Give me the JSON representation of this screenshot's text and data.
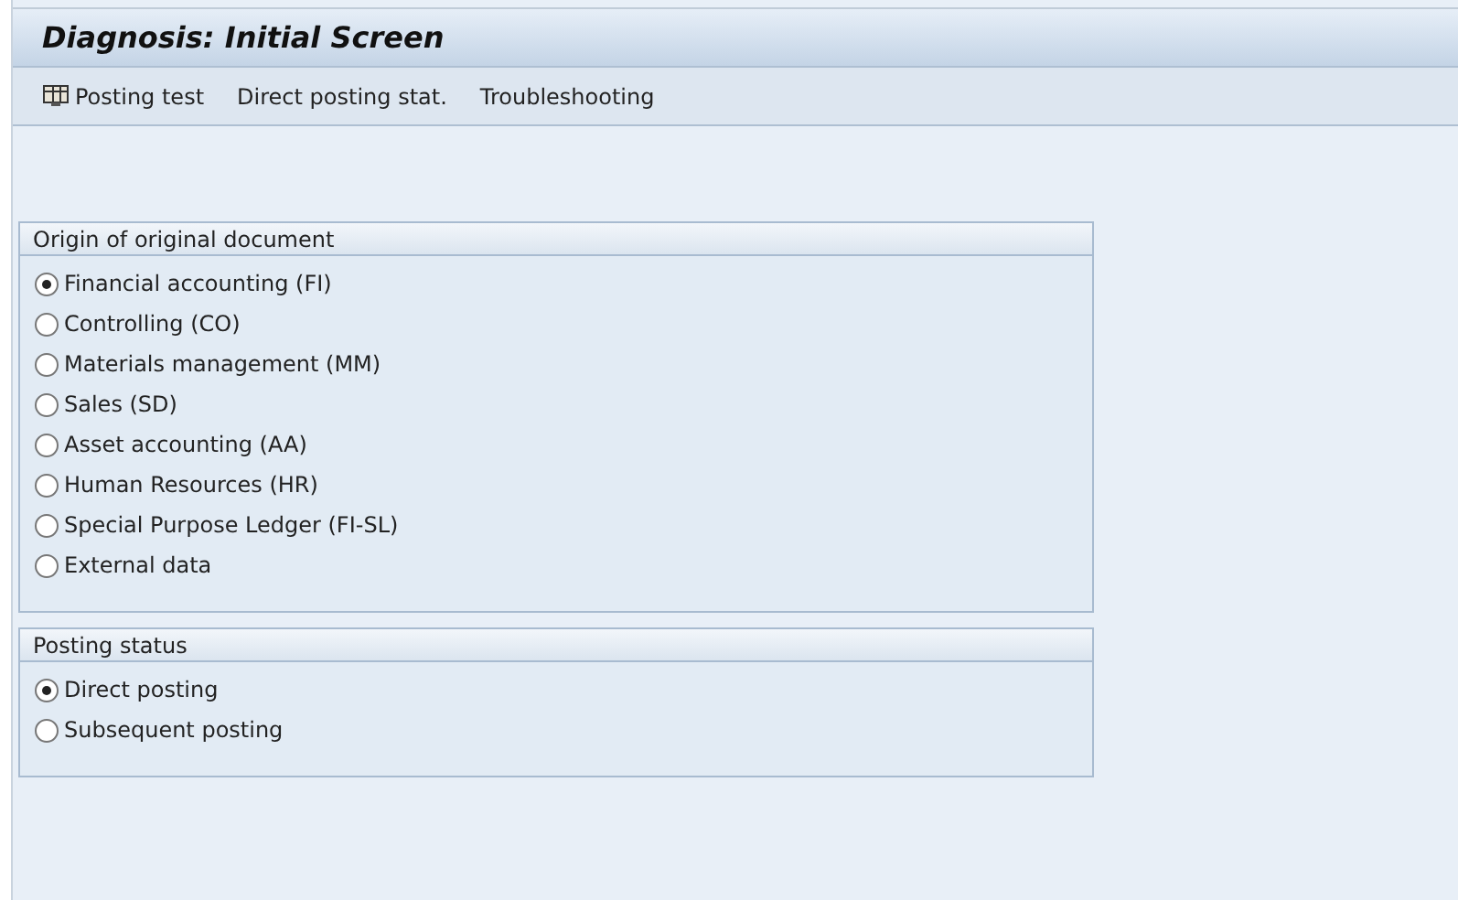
{
  "window": {
    "title": "Diagnosis: Initial Screen"
  },
  "toolbar": [
    {
      "label": "Posting test",
      "kind": "icon"
    },
    {
      "label": "Direct posting stat.",
      "kind": "text"
    },
    {
      "label": "Troubleshooting",
      "kind": "text"
    }
  ],
  "groups": [
    {
      "title": "Origin of original document",
      "options": [
        {
          "label": "Financial accounting (FI)",
          "selected": true
        },
        {
          "label": "Controlling (CO)",
          "selected": false
        },
        {
          "label": "Materials management (MM)",
          "selected": false
        },
        {
          "label": "Sales (SD)",
          "selected": false
        },
        {
          "label": "Asset accounting (AA)",
          "selected": false
        },
        {
          "label": "Human Resources (HR)",
          "selected": false
        },
        {
          "label": "Special Purpose Ledger (FI-SL)",
          "selected": false
        },
        {
          "label": "External data",
          "selected": false
        }
      ]
    },
    {
      "title": "Posting status",
      "options": [
        {
          "label": "Direct posting",
          "selected": true
        },
        {
          "label": "Subsequent posting",
          "selected": false
        }
      ]
    }
  ]
}
